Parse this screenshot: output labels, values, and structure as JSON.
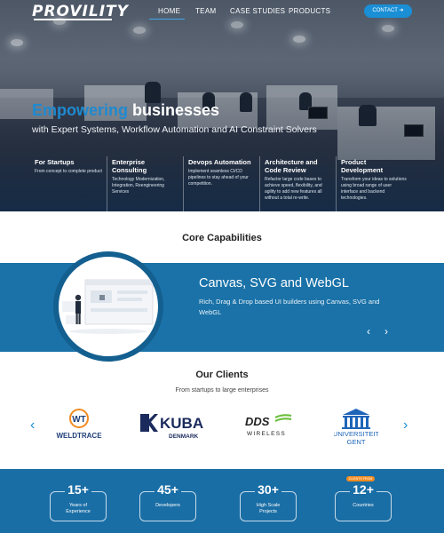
{
  "nav": {
    "logo": "PROVILITY",
    "items": [
      "HOME",
      "TEAM",
      "CASE STUDIES",
      "PRODUCTS"
    ],
    "contact_label": "CONTACT ➜"
  },
  "hero": {
    "title_accent": "Empowering",
    "title_rest": " businesses",
    "subtitle": "with Expert Systems, Workflow Automation and AI Constraint Solvers",
    "services": [
      {
        "title": "For Startups",
        "desc": "From concept to complete product"
      },
      {
        "title": "Enterprise Consulting",
        "desc": "Technology Modernization, Integration, Reengineering Services"
      },
      {
        "title": "Devops Automation",
        "desc": "Implement seamless CI/CD pipelines to stay ahead of your competition."
      },
      {
        "title": "Architecture and Code Review",
        "desc": "Refactor large code bases to achieve speed, flexibility, and agility to add new features all without a total re-write."
      },
      {
        "title": "Product Development",
        "desc": "Transform your ideas to solutions using broad range of user interface and backend technologies."
      }
    ]
  },
  "core": {
    "title": "Core Capabilities",
    "slide_title": "Canvas, SVG and WebGL",
    "slide_desc": "Rich, Drag & Drop based UI builders using Canvas, SVG and WebGL",
    "prev": "‹",
    "next": "›"
  },
  "clients": {
    "title": "Our Clients",
    "subtitle": "From startups to large enterprises",
    "prev": "‹",
    "next": "›",
    "logos": {
      "weld_badge": "WT",
      "weld": "WELDTRACE",
      "kuba_main": "KUBA",
      "kuba_sub": "DENMARK",
      "dds_main": "DDS",
      "dds_sub": "WIRELESS",
      "gent_main": "UNIVERSITEIT",
      "gent_sub": "GENT"
    }
  },
  "stats": {
    "badge": "CLIENTS FROM",
    "items": [
      {
        "value": "15+",
        "label_line1": "Years of",
        "label_line2": "Experience"
      },
      {
        "value": "45+",
        "label_line1": "Developers",
        "label_line2": ""
      },
      {
        "value": "30+",
        "label_line1": "High Scale",
        "label_line2": "Projects"
      },
      {
        "value": "12+",
        "label_line1": "Countries",
        "label_line2": ""
      }
    ]
  },
  "colors": {
    "accent": "#1a8fd6",
    "band": "#1a72a8",
    "stats_bg": "#1a6ea6",
    "badge": "#f28b1f"
  }
}
